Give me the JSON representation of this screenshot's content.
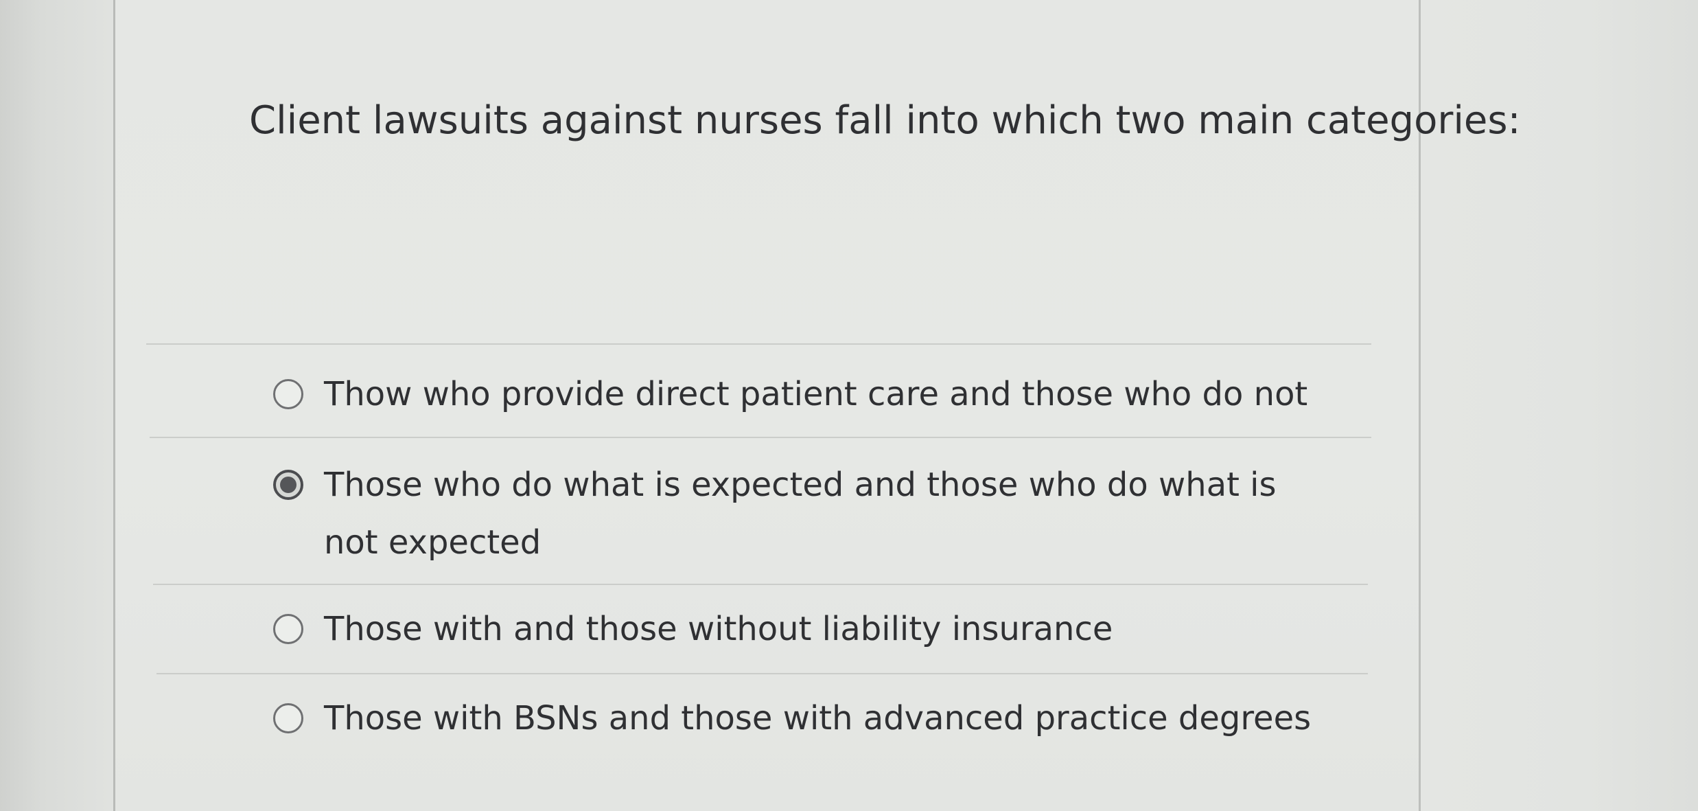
{
  "question": {
    "text": "Client lawsuits against nurses fall into which two main categories:"
  },
  "choices": [
    {
      "label": "Thow who provide direct patient care and those who do not",
      "selected": false
    },
    {
      "label": "Those who do what is expected and those who do what is not expected",
      "selected": true
    },
    {
      "label": "Those with and those without liability insurance",
      "selected": false
    },
    {
      "label": "Those with BSNs and those with advanced practice degrees",
      "selected": false
    }
  ],
  "colors": {
    "text": "#2f3033",
    "divider": "#cbcdca",
    "radio_border": "#6f7072",
    "radio_selected_dot": "#555659"
  }
}
